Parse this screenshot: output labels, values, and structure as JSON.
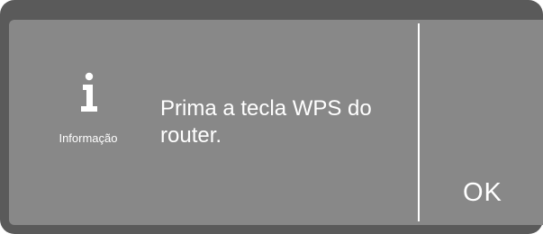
{
  "dialog": {
    "icon": "info-icon",
    "icon_label": "Informação",
    "message": "Prima a tecla WPS do router.",
    "ok_label": "OK"
  },
  "colors": {
    "bezel": "#5a5a5a",
    "screen": "#888888",
    "text": "#ffffff"
  }
}
